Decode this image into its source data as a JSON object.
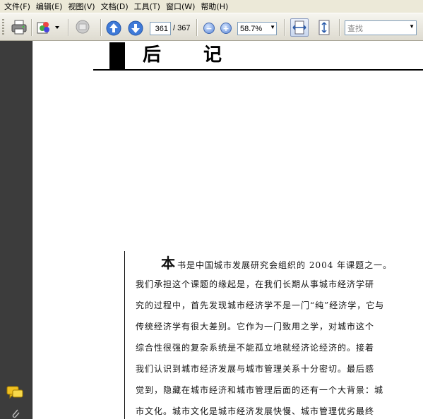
{
  "menu": {
    "items": [
      "文件(F)",
      "编辑(E)",
      "视图(V)",
      "文档(D)",
      "工具(T)",
      "窗口(W)",
      "帮助(H)"
    ]
  },
  "toolbar": {
    "current_page": "361",
    "total_pages": "/ 367",
    "zoom": "58.7%",
    "find_placeholder": "查找"
  },
  "icons": {
    "print": "print-icon",
    "pages": "organize-pages-icon",
    "collab": "collaborate-icon",
    "prev": "arrow-up-icon",
    "next": "arrow-down-icon",
    "zoom_out": "zoom-out-icon",
    "zoom_in": "zoom-in-icon",
    "fit_width": "fit-width-icon",
    "fit_page": "fit-page-icon",
    "comments": "comments-icon"
  },
  "document": {
    "heading_char1": "后",
    "heading_char2": "记",
    "dropcap": "本",
    "lines": [
      "书是中国城市发展研究会组织的 2004 年课题之一。",
      "我们承担这个课题的缘起是，在我们长期从事城市经济学研",
      "究的过程中，首先发现城市经济学不是一门“纯”经济学，它与",
      "传统经济学有很大差别。它作为一门致用之学，对城市这个",
      "综合性很强的复杂系统是不能孤立地就经济论经济的。接着",
      "我们认识到城市经济发展与城市管理关系十分密切。最后感",
      "觉到，隐藏在城市经济和城市管理后面的还有一个大背景：城",
      "市文化。城市文化是城市经济发展快慢、城市管理优劣最终"
    ]
  },
  "colors": {
    "chrome": "#ece9d8",
    "nav_panel": "#3c3c3c",
    "accent_blue": "#4a78d0"
  }
}
